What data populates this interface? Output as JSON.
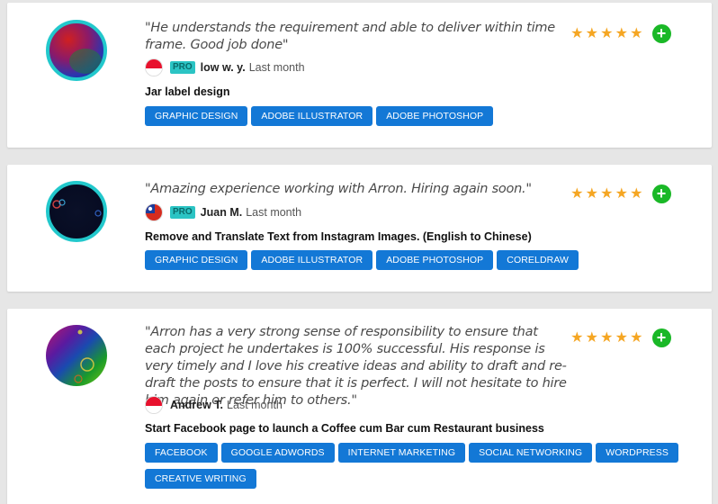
{
  "reviews": [
    {
      "quote": "\"He understands  the requirement and able to deliver within time frame. Good job done\"",
      "flag": "singapore-flag",
      "badge": "PRO",
      "name": "low w. y.",
      "time": "Last month",
      "project": "Jar label design",
      "tags": [
        "GRAPHIC DESIGN",
        "ADOBE ILLUSTRATOR",
        "ADOBE PHOTOSHOP"
      ],
      "rating": 5,
      "stars": [
        "★",
        "★",
        "★",
        "★",
        "★"
      ],
      "add": "+"
    },
    {
      "quote": "\"Amazing experience working with Arron. Hiring again soon.\"",
      "flag": "taiwan-flag",
      "badge": "PRO",
      "name": "Juan M.",
      "time": "Last month",
      "project": "Remove and Translate Text from Instagram Images. (English to Chinese)",
      "tags": [
        "GRAPHIC DESIGN",
        "ADOBE ILLUSTRATOR",
        "ADOBE PHOTOSHOP",
        "CORELDRAW"
      ],
      "rating": 5,
      "stars": [
        "★",
        "★",
        "★",
        "★",
        "★"
      ],
      "add": "+"
    },
    {
      "quote": "\"Arron has a very strong sense of responsibility to ensure that each project he undertakes is 100% successful.  His response is very timely and I love his creative ideas and ability to draft and re-draft the posts to ensure that it is perfect.  I will not hesitate to hire him again or refer him to others.\"",
      "flag": "singapore-flag",
      "name": "Andrew T.",
      "time": "Last month",
      "project": "Start Facebook page to launch a Coffee cum Bar cum Restaurant business",
      "tags": [
        "FACEBOOK",
        "GOOGLE ADWORDS",
        "INTERNET MARKETING",
        "SOCIAL NETWORKING",
        "WORDPRESS",
        "CREATIVE WRITING"
      ],
      "rating": 5,
      "stars": [
        "★",
        "★",
        "★",
        "★",
        "★"
      ],
      "add": "+"
    }
  ],
  "colors": {
    "tag": "#1378d6",
    "star": "#f5a623",
    "pro": "#2bc4c4",
    "add": "#1ab827",
    "ring": "#22c8cc"
  }
}
